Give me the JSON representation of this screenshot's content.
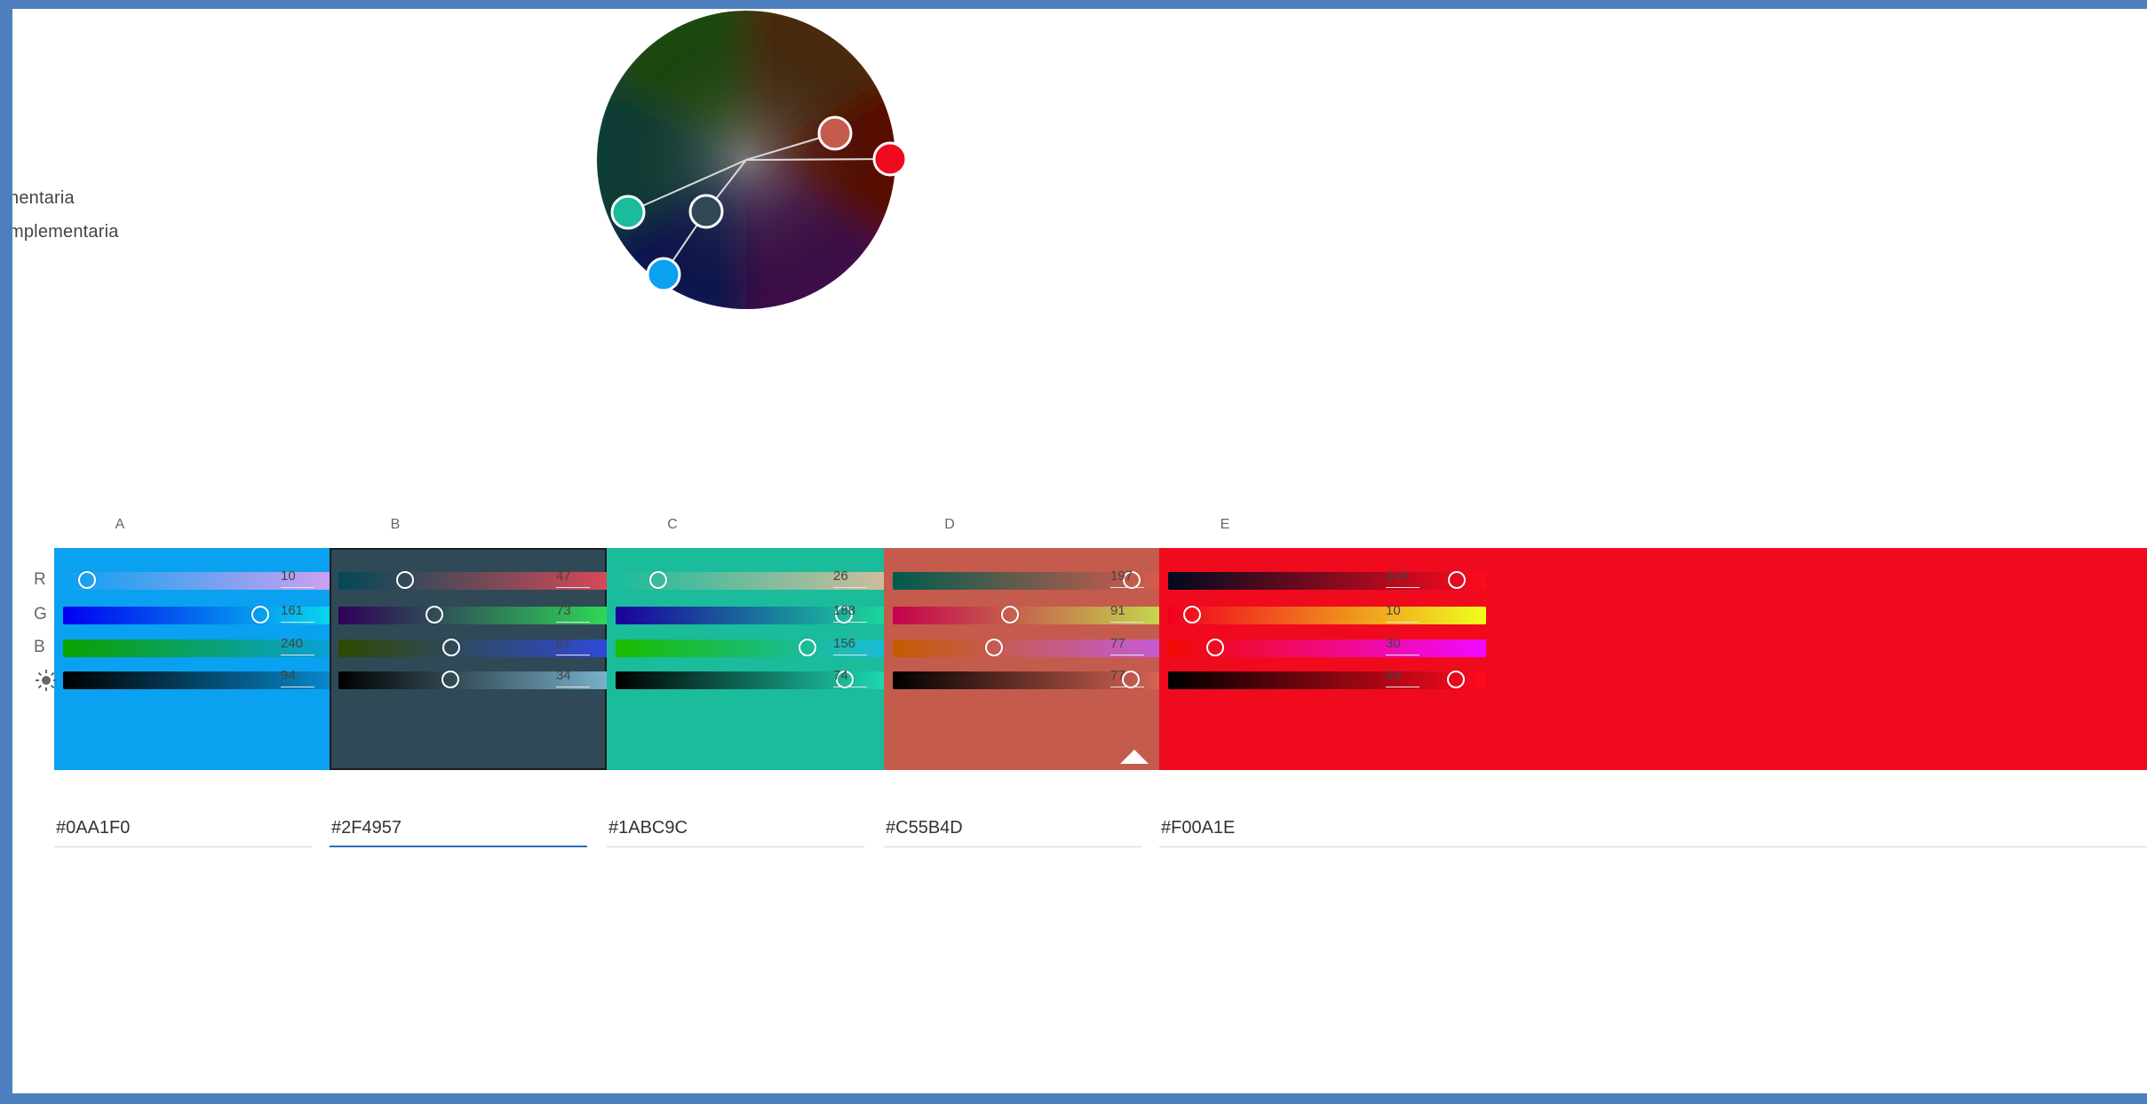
{
  "rules": [
    {
      "label": "nentaria"
    },
    {
      "label": "mplementaria"
    }
  ],
  "wheel": {
    "handles": [
      {
        "name": "A",
        "color": "#0AA1F0",
        "base": false
      },
      {
        "name": "B",
        "color": "#2F4957",
        "base": true
      },
      {
        "name": "C",
        "color": "#1ABC9C",
        "base": false
      },
      {
        "name": "D",
        "color": "#C55B4D",
        "base": false
      },
      {
        "name": "E",
        "color": "#F00A1E",
        "base": false
      }
    ]
  },
  "columns": [
    {
      "letter": "A",
      "hex": "#0AA1F0",
      "color": "#0AA1F0",
      "selected": false,
      "values": {
        "r": "10",
        "g": "161",
        "b": "240",
        "brightness": "94"
      }
    },
    {
      "letter": "B",
      "hex": "#2F4957",
      "color": "#2F4957",
      "selected": true,
      "values": {
        "r": "47",
        "g": "73",
        "b": "87",
        "brightness": "34"
      }
    },
    {
      "letter": "C",
      "hex": "#1ABC9C",
      "color": "#1ABC9C",
      "selected": false,
      "values": {
        "r": "26",
        "g": "188",
        "b": "156",
        "brightness": "74"
      }
    },
    {
      "letter": "D",
      "hex": "#C55B4D",
      "color": "#C55B4D",
      "selected": false,
      "values": {
        "r": "197",
        "g": "91",
        "b": "77",
        "brightness": "77"
      }
    },
    {
      "letter": "E",
      "hex": "#F00A1E",
      "color": "#F00A1E",
      "selected": false,
      "values": {
        "r": "240",
        "g": "10",
        "b": "30",
        "brightness": "94"
      }
    }
  ],
  "channel_labels": {
    "r": "R",
    "g": "G",
    "b": "B",
    "brightness_icon": "brightness-icon"
  }
}
